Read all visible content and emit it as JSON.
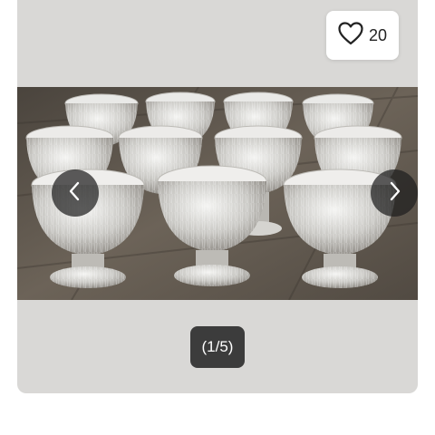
{
  "listing": {
    "favorite_count": "20",
    "image_counter": "(1/5)"
  },
  "icons": {
    "favorite": "heart-outline-icon",
    "previous": "chevron-left-icon",
    "next": "chevron-right-icon"
  },
  "colors": {
    "card_background": "#d9d8d6",
    "nav_button": "#1e1e1e",
    "counter_badge": "#3c3c3c"
  }
}
